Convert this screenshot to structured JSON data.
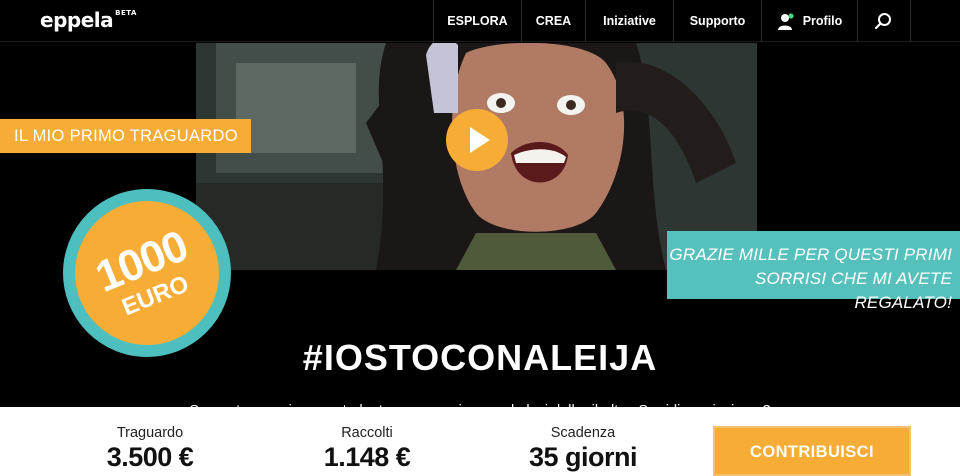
{
  "nav": {
    "logo": "eppela",
    "logo_badge": "BETA",
    "items": [
      {
        "label": "ESPLORA"
      },
      {
        "label": "CREA"
      },
      {
        "label": "Iniziative"
      },
      {
        "label": "Supporto"
      }
    ],
    "profile_label": "Profilo",
    "search_icon": "search-icon"
  },
  "hero": {
    "ribbon_left": "IL MIO PRIMO TRAGUARDO",
    "goal_amount": "1000",
    "goal_unit": "EURO",
    "ribbon_right_line1": "GRAZIE MILLE PER QUESTI PRIMI",
    "ribbon_right_line2": "SORRISI CHE MI AVETE REGALATO!",
    "hashtag": "#IOSTOCONALEIJA",
    "subtitle": "Supporta una giovane studentessa a raggiungere le luci della ribalta...Sorridiamo insieme?"
  },
  "stats": {
    "goal_label": "Traguardo",
    "goal_value": "3.500 €",
    "raised_label": "Raccolti",
    "raised_value": "1.148 €",
    "deadline_label": "Scadenza",
    "deadline_value": "35 giorni",
    "contribute_label": "CONTRIBUISCI"
  },
  "colors": {
    "accent_orange": "#f6ac35",
    "accent_teal": "#56c0bd",
    "background": "#000000"
  }
}
